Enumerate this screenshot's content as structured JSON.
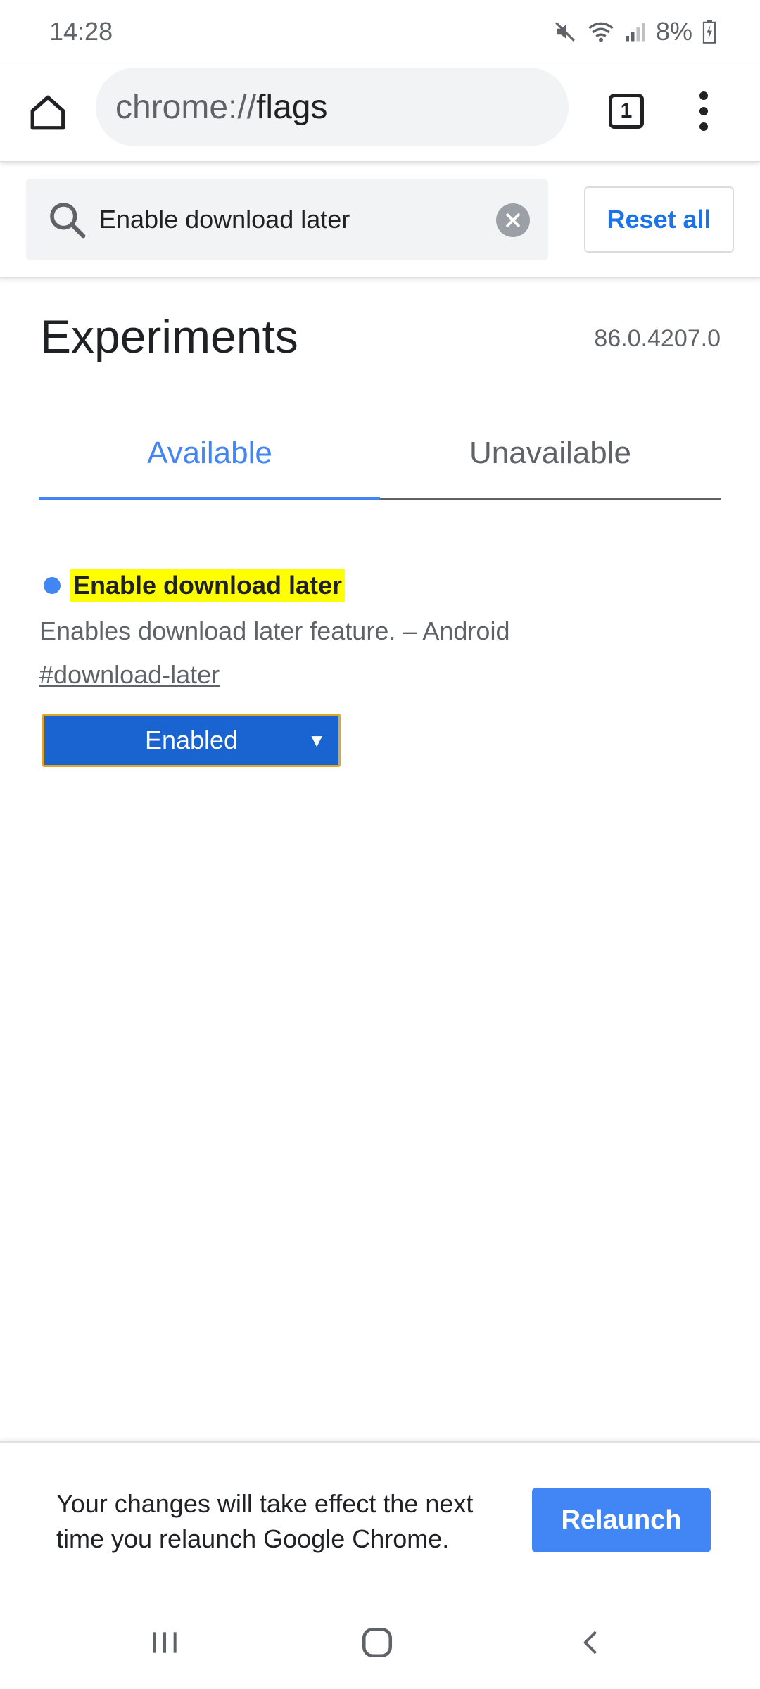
{
  "status_bar": {
    "time": "14:28",
    "battery_text": "8%",
    "icons": [
      "mute-icon",
      "wifi-icon",
      "signal-icon",
      "battery-icon"
    ]
  },
  "toolbar": {
    "url_prefix": "chrome://",
    "url_host": "flags",
    "tab_count": "1"
  },
  "search": {
    "value": "Enable download later",
    "reset_label": "Reset all"
  },
  "header": {
    "title": "Experiments",
    "version": "86.0.4207.0"
  },
  "tabs": [
    {
      "label": "Available",
      "active": true
    },
    {
      "label": "Unavailable",
      "active": false
    }
  ],
  "experiment": {
    "title": "Enable download later",
    "description": "Enables download later feature. – Android",
    "link": "#download-later",
    "selected_option": "Enabled"
  },
  "relaunch": {
    "message": "Your changes will take effect the next time you relaunch Google Chrome.",
    "button_label": "Relaunch"
  },
  "colors": {
    "accent": "#4285f4",
    "highlight": "#ffff00",
    "select_bg": "#1a64d2",
    "select_border": "#e3a42a"
  }
}
